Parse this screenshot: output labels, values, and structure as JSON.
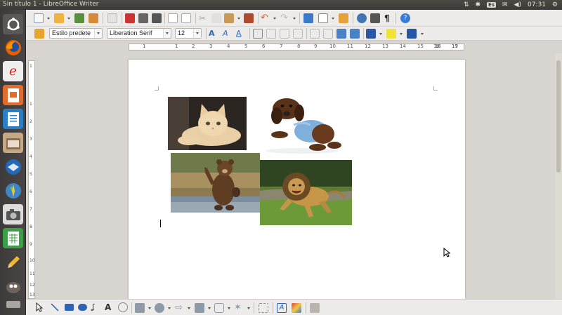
{
  "window": {
    "title": "Sin título 1 - LibreOffice Writer"
  },
  "tray": {
    "keyboard": "Es",
    "time": "07:31"
  },
  "launcher": {
    "items": [
      {
        "name": "dash-home-button",
        "icon": "ubuntu-logo-icon"
      },
      {
        "name": "firefox-launcher",
        "icon": "firefox-icon"
      },
      {
        "name": "email-launcher",
        "icon": "envelope-icon"
      },
      {
        "name": "impress-launcher",
        "icon": "presentation-icon"
      },
      {
        "name": "writer-launcher",
        "icon": "document-icon"
      },
      {
        "name": "files-launcher",
        "icon": "drawer-icon"
      },
      {
        "name": "thunderbird-launcher",
        "icon": "thunderbird-icon"
      },
      {
        "name": "web-launcher",
        "icon": "globe-icon"
      },
      {
        "name": "camera-launcher",
        "icon": "camera-icon"
      },
      {
        "name": "calc-launcher",
        "icon": "spreadsheet-icon"
      },
      {
        "name": "editor-launcher",
        "icon": "pencil-icon"
      },
      {
        "name": "gimp-launcher",
        "icon": "gimp-icon"
      },
      {
        "name": "drive-launcher",
        "icon": "drive-icon"
      }
    ]
  },
  "format": {
    "paragraph_style": "Estilo predete",
    "font_name": "Liberation Serif",
    "font_size": "12"
  },
  "ruler": {
    "marks": [
      "1",
      "1",
      "2",
      "3",
      "4",
      "5",
      "6",
      "7",
      "8",
      "9",
      "10",
      "11",
      "12",
      "13",
      "14",
      "15",
      "16",
      "17",
      "18",
      "19"
    ]
  },
  "vruler": {
    "marks": [
      "1",
      "1",
      "2",
      "3",
      "4",
      "5",
      "6",
      "7",
      "8",
      "9",
      "10",
      "11",
      "12",
      "13"
    ]
  },
  "document": {
    "images": [
      {
        "name": "kitten-image",
        "subject": "kitten"
      },
      {
        "name": "puppy-image",
        "subject": "puppy in blue sweater"
      },
      {
        "name": "bear-image",
        "subject": "waving bear"
      },
      {
        "name": "lion-image",
        "subject": "running lion"
      }
    ]
  }
}
